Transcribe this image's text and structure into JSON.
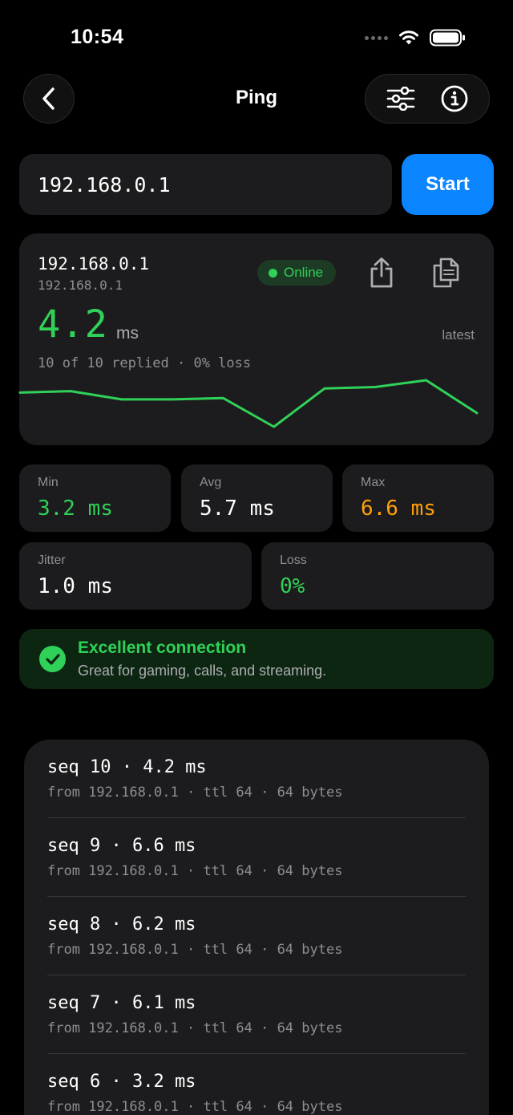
{
  "status_bar": {
    "time": "10:54"
  },
  "nav": {
    "title": "Ping",
    "icons": [
      "chevron-left-icon",
      "sliders-icon",
      "info-icon"
    ]
  },
  "host_input": {
    "value": "192.168.0.1"
  },
  "start_button": {
    "label": "Start"
  },
  "result": {
    "host": "192.168.0.1",
    "ip": "192.168.0.1",
    "status": "Online",
    "latency": "4.2",
    "unit": "ms",
    "latest_label": "latest",
    "replied": "10 of 10 replied · 0% loss",
    "sparkline_ms": [
      5.7,
      5.8,
      5.2,
      5.2,
      5.3,
      3.2,
      6.0,
      6.1,
      6.6,
      4.2
    ],
    "accent_color": "#30d158"
  },
  "stats": {
    "min": {
      "label": "Min",
      "value": "3.2 ms"
    },
    "avg": {
      "label": "Avg",
      "value": "5.7 ms"
    },
    "max": {
      "label": "Max",
      "value": "6.6 ms"
    },
    "jitter": {
      "label": "Jitter",
      "value": "1.0 ms"
    },
    "loss": {
      "label": "Loss",
      "value": "0%"
    }
  },
  "quality": {
    "title": "Excellent connection",
    "subtitle": "Great for gaming, calls, and streaming."
  },
  "replies": [
    {
      "main": "seq 10 · 4.2 ms",
      "sub": "from 192.168.0.1 · ttl 64 · 64 bytes"
    },
    {
      "main": "seq 9 · 6.6 ms",
      "sub": "from 192.168.0.1 · ttl 64 · 64 bytes"
    },
    {
      "main": "seq 8 · 6.2 ms",
      "sub": "from 192.168.0.1 · ttl 64 · 64 bytes"
    },
    {
      "main": "seq 7 · 6.1 ms",
      "sub": "from 192.168.0.1 · ttl 64 · 64 bytes"
    },
    {
      "main": "seq 6 · 3.2 ms",
      "sub": "from 192.168.0.1 · ttl 64 · 64 bytes"
    }
  ]
}
